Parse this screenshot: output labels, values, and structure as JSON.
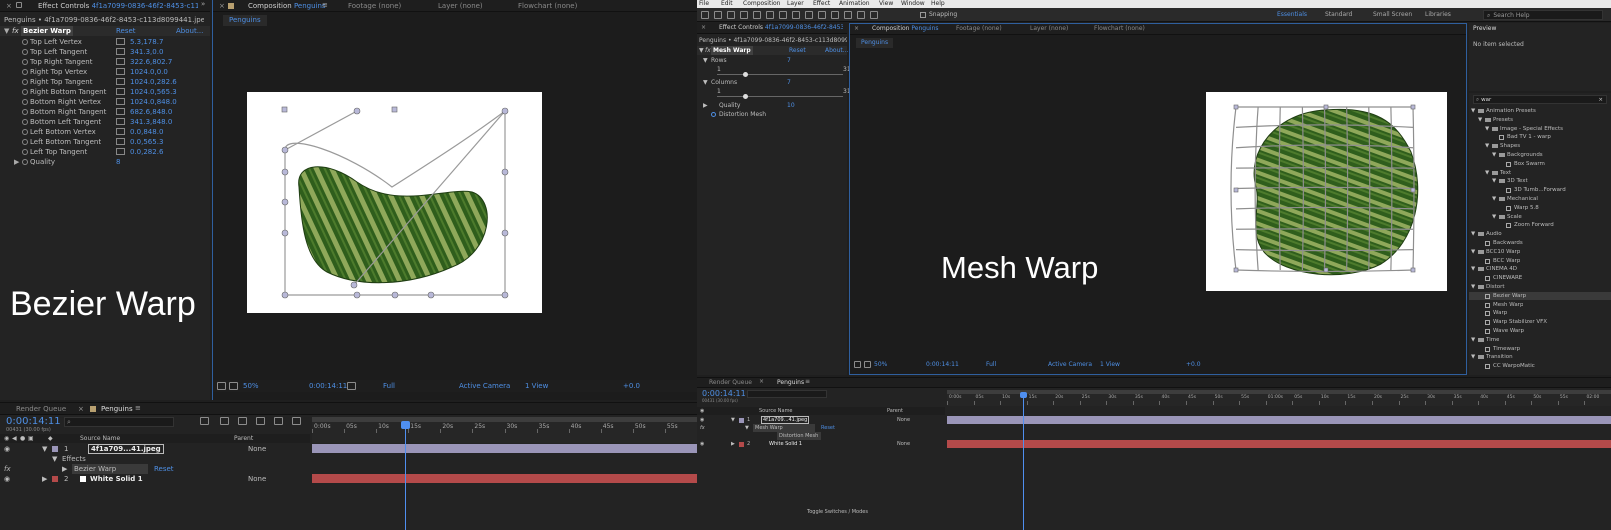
{
  "left": {
    "effect_controls": {
      "tab_label": "Effect Controls",
      "tab_file": "4f1a7099-0836-46f2-8453-c113d809",
      "breadcrumb": "Penguins • 4f1a7099-0836-46f2-8453-c113d8099441.jpeg",
      "effect_name": "Bezier Warp",
      "reset": "Reset",
      "about": "About...",
      "params": [
        {
          "label": "Top Left Vertex",
          "value": "5.3,178.7"
        },
        {
          "label": "Top Left Tangent",
          "value": "341.3,0.0"
        },
        {
          "label": "Top Right Tangent",
          "value": "322.6,802.7"
        },
        {
          "label": "Right Top Vertex",
          "value": "1024.0,0.0"
        },
        {
          "label": "Right Top Tangent",
          "value": "1024.0,282.6"
        },
        {
          "label": "Right Bottom Tangent",
          "value": "1024.0,565.3"
        },
        {
          "label": "Bottom Right Vertex",
          "value": "1024.0,848.0"
        },
        {
          "label": "Bottom Right Tangent",
          "value": "682.6,848.0"
        },
        {
          "label": "Bottom Left Tangent",
          "value": "341.3,848.0"
        },
        {
          "label": "Left Bottom Vertex",
          "value": "0.0,848.0"
        },
        {
          "label": "Left Bottom Tangent",
          "value": "0.0,565.3"
        },
        {
          "label": "Left Top Tangent",
          "value": "0.0,282.6"
        }
      ],
      "quality_label": "Quality",
      "quality_value": "8"
    },
    "composition": {
      "tab_label": "Composition",
      "tab_name": "Penguins",
      "footage_tab": "Footage (none)",
      "layer_tab": "Layer (none)",
      "flowchart_tab": "Flowchart (none)",
      "sub_tab": "Penguins"
    },
    "viewer_bar": {
      "zoom": "50%",
      "timecode": "0:00:14:11",
      "resolution": "Full",
      "camera": "Active Camera",
      "view": "1 View",
      "exposure": "+0.0"
    },
    "timeline": {
      "render_queue": "Render Queue",
      "comp_tab": "Penguins",
      "timecode": "0:00:14:11",
      "fps": "00431 (30.00 fps)",
      "col_source_name": "Source Name",
      "col_parent": "Parent",
      "ruler": [
        "0:00s",
        "05s",
        "10s",
        "15s",
        "20s",
        "25s",
        "30s",
        "35s",
        "40s",
        "45s",
        "50s",
        "55s"
      ],
      "layer1_num": "1",
      "layer1_name": "4f1a709...41.jpeg",
      "effects_label": "Effects",
      "effect_row": "Bezier Warp",
      "reset": "Reset",
      "layer2_num": "2",
      "layer2_name": "White Solid 1",
      "parent_none": "None",
      "fx": "fx"
    },
    "overlay_title": "Bezier Warp"
  },
  "right": {
    "menu": [
      "File",
      "Edit",
      "Composition",
      "Layer",
      "Effect",
      "Animation",
      "View",
      "Window",
      "Help"
    ],
    "snapping": "Snapping",
    "workspaces": [
      "Essentials",
      "Standard",
      "Small Screen",
      "Libraries"
    ],
    "search_help": "Search Help",
    "effect_controls": {
      "tab_label": "Effect Controls",
      "tab_file": "4f1a7099-0836-46f2-8453-c113d809",
      "breadcrumb": "Penguins • 4f1a7099-0836-46f2-8453-c113d8099441.jpeg",
      "effect_name": "Mesh Warp",
      "reset": "Reset",
      "about": "About...",
      "rows_label": "Rows",
      "rows_value": "7",
      "rows_min": "1",
      "rows_max": "31",
      "columns_label": "Columns",
      "columns_value": "7",
      "columns_min": "1",
      "columns_max": "31",
      "quality_label": "Quality",
      "quality_value": "10",
      "distortion_mesh": "Distortion Mesh"
    },
    "composition": {
      "tab_label": "Composition",
      "tab_name": "Penguins",
      "footage_tab": "Footage (none)",
      "layer_tab": "Layer (none)",
      "flowchart_tab": "Flowchart (none)",
      "sub_tab": "Penguins"
    },
    "viewer_bar": {
      "zoom": "50%",
      "timecode": "0:00:14:11",
      "resolution": "Full",
      "camera": "Active Camera",
      "view": "1 View",
      "exposure": "+0.0"
    },
    "preview": {
      "tab": "Preview",
      "no_item": "No item selected",
      "search_value": "war"
    },
    "presets_tree": [
      {
        "label": "Animation Presets",
        "level": 0,
        "type": "folder"
      },
      {
        "label": "Presets",
        "level": 1,
        "type": "folder"
      },
      {
        "label": "Image - Special Effects",
        "level": 2,
        "type": "folder"
      },
      {
        "label": "Bad TV 1 - warp",
        "level": 3,
        "type": "item"
      },
      {
        "label": "Shapes",
        "level": 2,
        "type": "folder"
      },
      {
        "label": "Backgrounds",
        "level": 3,
        "type": "folder"
      },
      {
        "label": "Box Swarm",
        "level": 4,
        "type": "item"
      },
      {
        "label": "Text",
        "level": 2,
        "type": "folder"
      },
      {
        "label": "3D Text",
        "level": 3,
        "type": "folder"
      },
      {
        "label": "3D Tumb...Forward",
        "level": 4,
        "type": "item"
      },
      {
        "label": "Mechanical",
        "level": 3,
        "type": "folder"
      },
      {
        "label": "Warp 5.8",
        "level": 4,
        "type": "item"
      },
      {
        "label": "Scale",
        "level": 3,
        "type": "folder"
      },
      {
        "label": "Zoom Forward",
        "level": 4,
        "type": "item"
      },
      {
        "label": "Audio",
        "level": 0,
        "type": "folder"
      },
      {
        "label": "Backwards",
        "level": 1,
        "type": "item"
      },
      {
        "label": "BCC10 Warp",
        "level": 0,
        "type": "folder"
      },
      {
        "label": "BCC Warp",
        "level": 1,
        "type": "item"
      },
      {
        "label": "CINEMA 4D",
        "level": 0,
        "type": "folder"
      },
      {
        "label": "CINEWARE",
        "level": 1,
        "type": "item"
      },
      {
        "label": "Distort",
        "level": 0,
        "type": "folder"
      },
      {
        "label": "Bezier Warp",
        "level": 1,
        "type": "item",
        "selected": true
      },
      {
        "label": "Mesh Warp",
        "level": 1,
        "type": "item"
      },
      {
        "label": "Warp",
        "level": 1,
        "type": "item"
      },
      {
        "label": "Warp Stabilizer VFX",
        "level": 1,
        "type": "item"
      },
      {
        "label": "Wave Warp",
        "level": 1,
        "type": "item"
      },
      {
        "label": "Time",
        "level": 0,
        "type": "folder"
      },
      {
        "label": "Timewarp",
        "level": 1,
        "type": "item"
      },
      {
        "label": "Transition",
        "level": 0,
        "type": "folder"
      },
      {
        "label": "CC WarpoMatic",
        "level": 1,
        "type": "item"
      }
    ],
    "timeline": {
      "render_queue": "Render Queue",
      "comp_tab": "Penguins",
      "timecode": "0:00:14:11",
      "fps": "00431 (30.00 fps)",
      "col_source_name": "Source Name",
      "col_parent": "Parent",
      "ruler": [
        "0:00s",
        "05s",
        "10s",
        "15s",
        "20s",
        "25s",
        "30s",
        "35s",
        "40s",
        "45s",
        "50s",
        "55s",
        "01:00s",
        "05s",
        "10s",
        "15s",
        "20s",
        "25s",
        "30s",
        "35s",
        "40s",
        "45s",
        "50s",
        "55s",
        "02:00"
      ],
      "layer1_num": "1",
      "layer1_name": "4f1a709...41.jpeg",
      "effect_row": "Mesh Warp",
      "reset": "Reset",
      "distortion_mesh": "Distortion Mesh",
      "layer2_num": "2",
      "layer2_name": "White Solid 1",
      "parent_none": "None",
      "fx": "fx",
      "toggle": "Toggle Switches / Modes"
    },
    "overlay_title": "Mesh Warp"
  },
  "colors": {
    "accent": "#4e8fe4",
    "layer_bar": "#9a95b8",
    "solid_bar": "#b44a4a",
    "playhead": "#4f8ff0"
  }
}
